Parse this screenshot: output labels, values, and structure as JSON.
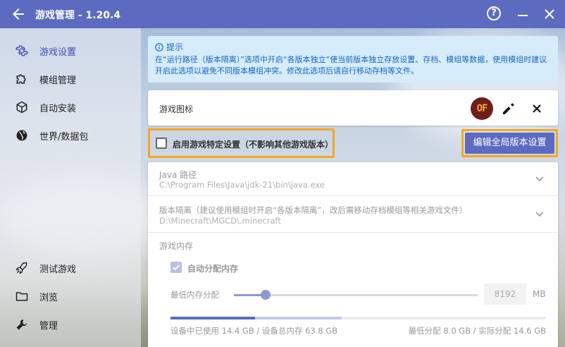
{
  "window": {
    "title": "游戏管理 - 1.20.4",
    "help_glyph": "?"
  },
  "sidebar": {
    "items": [
      {
        "label": "游戏设置",
        "icon": "gear-icon",
        "active": true
      },
      {
        "label": "模组管理",
        "icon": "puzzle-icon"
      },
      {
        "label": "自动安装",
        "icon": "cube-icon"
      },
      {
        "label": "世界/数据包",
        "icon": "globe-icon"
      },
      {
        "label": "测试游戏",
        "icon": "rocket-icon"
      },
      {
        "label": "浏览",
        "icon": "folder-icon"
      },
      {
        "label": "管理",
        "icon": "wrench-icon"
      }
    ]
  },
  "hint": {
    "title": "提示",
    "body": "在“运行路径（版本隔离）”选项中开启“各版本独立”使当前版本独立存放设置、存档、模组等数据，使用模组时建议开启此选项以避免不同版本模组冲突。修改此选项后请自行移动存档等文件。"
  },
  "game_icon": {
    "label": "游戏图标",
    "icon_text": "OF"
  },
  "specific_setting": {
    "label": "启用游戏特定设置（不影响其他游戏版本）",
    "checked": false
  },
  "global_button": {
    "label": "编辑全局版本设置"
  },
  "java": {
    "title": "Java 路径",
    "value": "C:\\Program Files\\Java\\jdk-21\\bin\\java.exe"
  },
  "isolation": {
    "title": "版本隔离（建议使用模组时开启“各版本隔离”，改后需移动存档模组等相关游戏文件）",
    "value": "D:\\Minecraft\\MGCD\\.minecraft"
  },
  "memory": {
    "title": "游戏内存",
    "auto_label": "自动分配内存",
    "auto_checked": true,
    "min_label": "最低内存分配",
    "slider_fraction": 0.13,
    "value": "8192",
    "unit": "MB",
    "used_fraction": 0.226,
    "alloc_fraction": 0.229,
    "usage_left": "设备中已使用 14.4 GB / 设备总内存 63.8 GB",
    "usage_right": "最低分配 8.0 GB / 实际分配 14.6 GB"
  },
  "colors": {
    "accent": "#5c6bc0",
    "highlight": "#f5a623",
    "hint_bg": "#d6ecfa"
  }
}
